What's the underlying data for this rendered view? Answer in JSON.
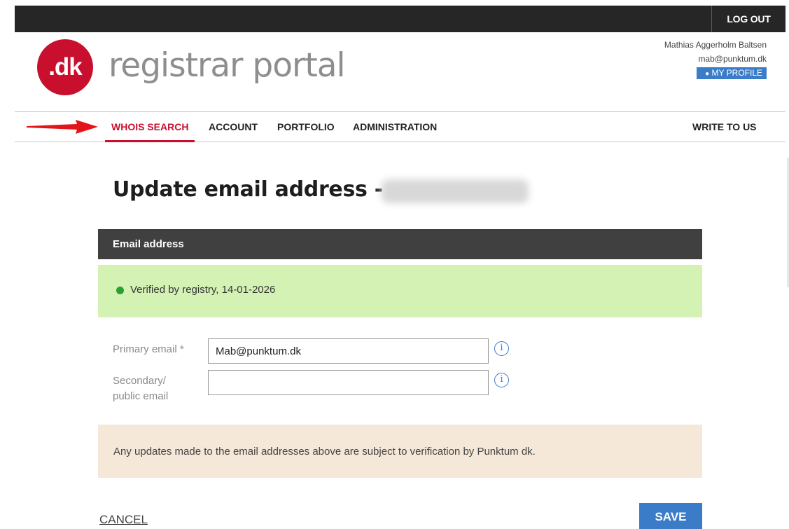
{
  "topbar": {
    "logout_label": "LOG OUT"
  },
  "header": {
    "logo_text": ".dk",
    "title": "registrar portal",
    "user_name": "Mathias Aggerholm Baltsen",
    "user_email": "mab@punktum.dk",
    "profile_label": "MY PROFILE"
  },
  "nav": {
    "items": [
      "WHOIS SEARCH",
      "ACCOUNT",
      "PORTFOLIO",
      "ADMINISTRATION"
    ],
    "right_item": "WRITE TO US",
    "active": "WHOIS SEARCH"
  },
  "page": {
    "title": "Update email address -"
  },
  "section": {
    "header": "Email address"
  },
  "verification": {
    "text": "Verified by registry, 14-01-2026",
    "status_color": "#2aa12c"
  },
  "form": {
    "primary_label": "Primary email *",
    "primary_value": "Mab@punktum.dk",
    "secondary_label_line1": "Secondary/",
    "secondary_label_line2": "public email",
    "secondary_value": ""
  },
  "notice": {
    "text": "Any updates made to the email addresses above are subject to verification by Punktum dk."
  },
  "actions": {
    "cancel_label": "CANCEL",
    "save_label": "SAVE"
  },
  "colors": {
    "brand_red": "#c8102e",
    "accent_blue": "#3b7cc9",
    "verified_bg": "#d5f2b5",
    "notice_bg": "#f5e8d8",
    "dark_bar": "#262626"
  }
}
